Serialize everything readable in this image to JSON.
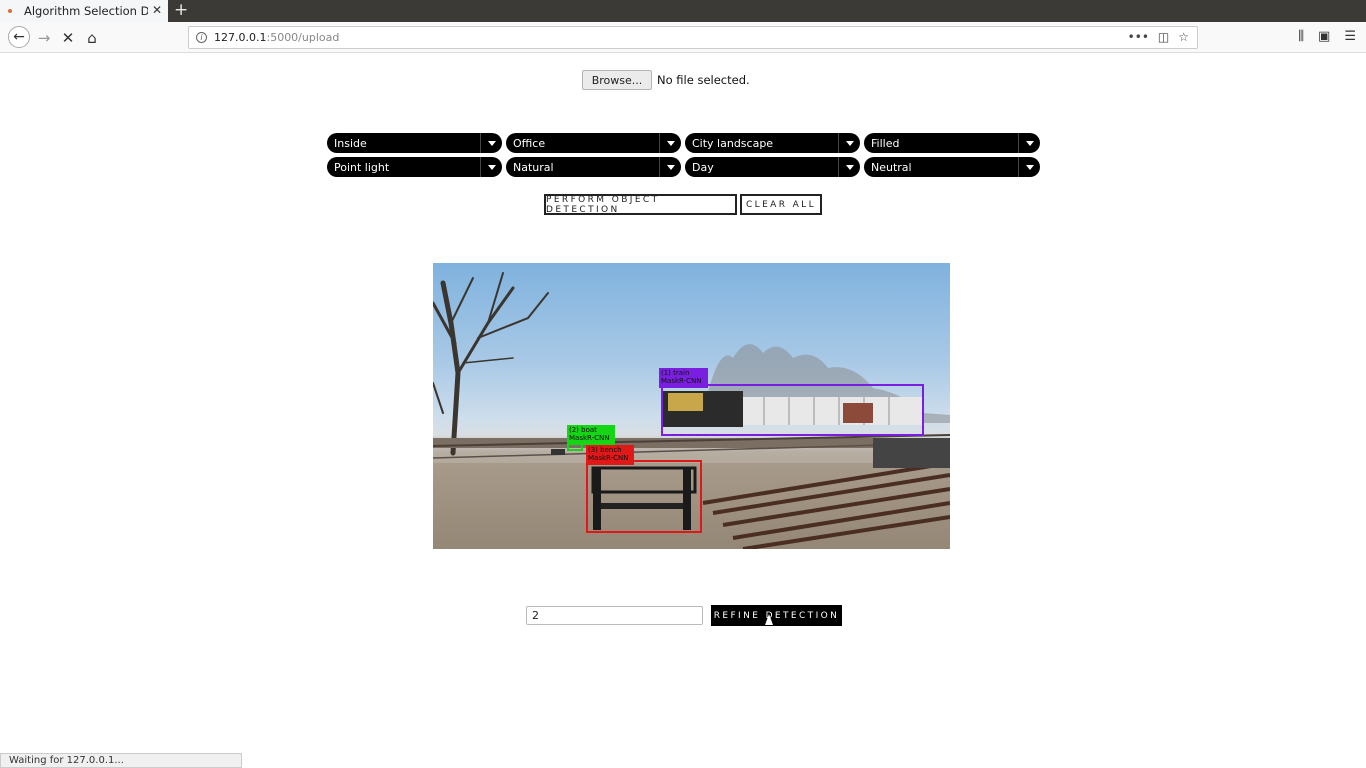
{
  "browser": {
    "tab_title": "Algorithm Selection De",
    "tab_close": "✕",
    "new_tab": "+",
    "url_host": "127.0.0.1",
    "url_path": ":5000/upload",
    "url_actions": [
      "•••",
      "◫",
      "☆"
    ],
    "toolbar_icons": [
      "library-icon",
      "sidebar-icon",
      "menu-icon"
    ],
    "status_text": "Waiting for 127.0.0.1..."
  },
  "upload": {
    "browse_label": "Browse...",
    "file_status": "No file selected."
  },
  "selects": [
    {
      "value": "Inside"
    },
    {
      "value": "Office"
    },
    {
      "value": "City landscape"
    },
    {
      "value": "Filled"
    },
    {
      "value": "Point light"
    },
    {
      "value": "Natural"
    },
    {
      "value": "Day"
    },
    {
      "value": "Neutral"
    }
  ],
  "actions": {
    "perform_label": "PERFORM OBJECT DETECTION",
    "clear_label": "CLEAR ALL"
  },
  "detections": [
    {
      "label_line1": "(1) train",
      "label_line2": "MaskR-CNN",
      "color": "#7a1fe0"
    },
    {
      "label_line1": "(2) boat",
      "label_line2": "MaskR-CNN",
      "color": "#15d615"
    },
    {
      "label_line1": "(3) bench",
      "label_line2": "MaskR-CNN",
      "color": "#e01818"
    }
  ],
  "refine": {
    "input_value": "2",
    "button_label": "REFINE DETECTION"
  }
}
